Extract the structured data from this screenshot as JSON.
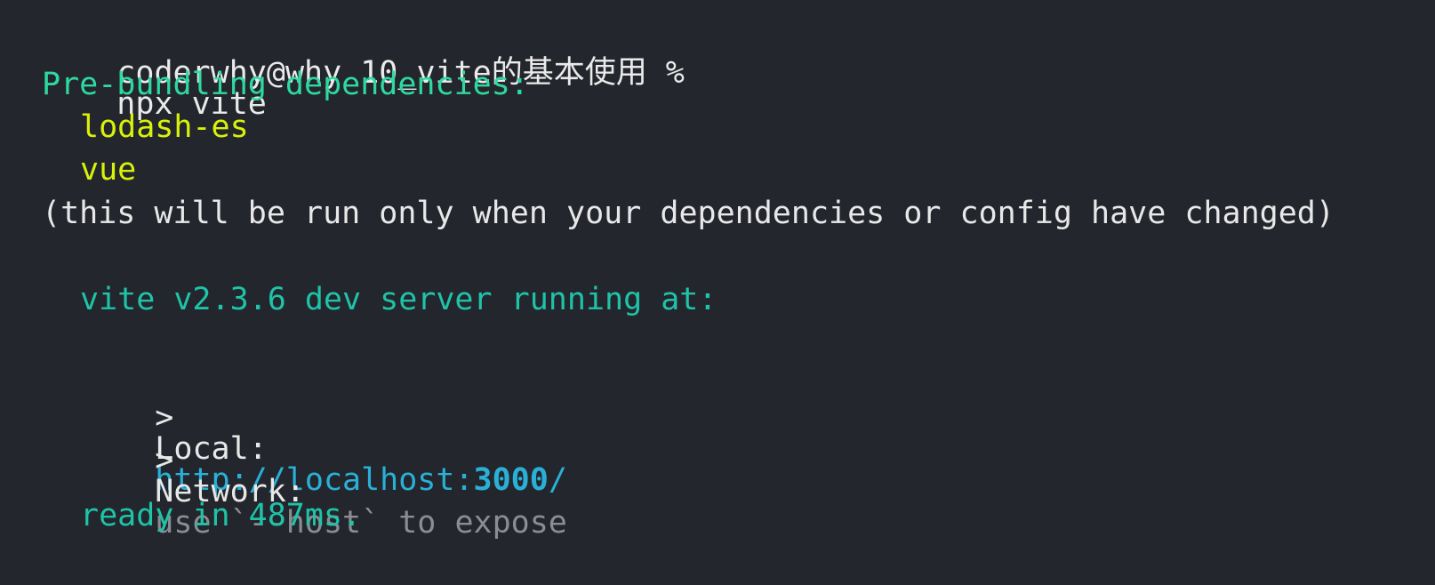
{
  "terminal": {
    "prompt": {
      "user_host_dir": "coderwhy@why 10_vite的基本使用 %",
      "command": "npx vite"
    },
    "prebundle": {
      "heading": "Pre-bundling dependencies:",
      "deps": [
        "lodash-es",
        "vue"
      ],
      "note": "(this will be run only when your dependencies or config have changed)"
    },
    "server": {
      "running": "vite v2.3.6 dev server running at:",
      "local_arrow": ">",
      "local_label": "Local:",
      "local_url_base": "http://localhost:",
      "local_url_port": "3000",
      "local_url_tail": "/",
      "network_arrow": ">",
      "network_label": "Network:",
      "network_hint": "use `--host` to expose",
      "ready": "ready in 487ms."
    }
  },
  "colors": {
    "background": "#23262d",
    "prompt_text": "#eaeaea",
    "heading_green": "#2ed9a0",
    "deps_yellow": "#d8f20a",
    "server_teal": "#1fc3a8",
    "url_blue": "#2ab0d6",
    "dim_gray": "#8a8d92"
  }
}
